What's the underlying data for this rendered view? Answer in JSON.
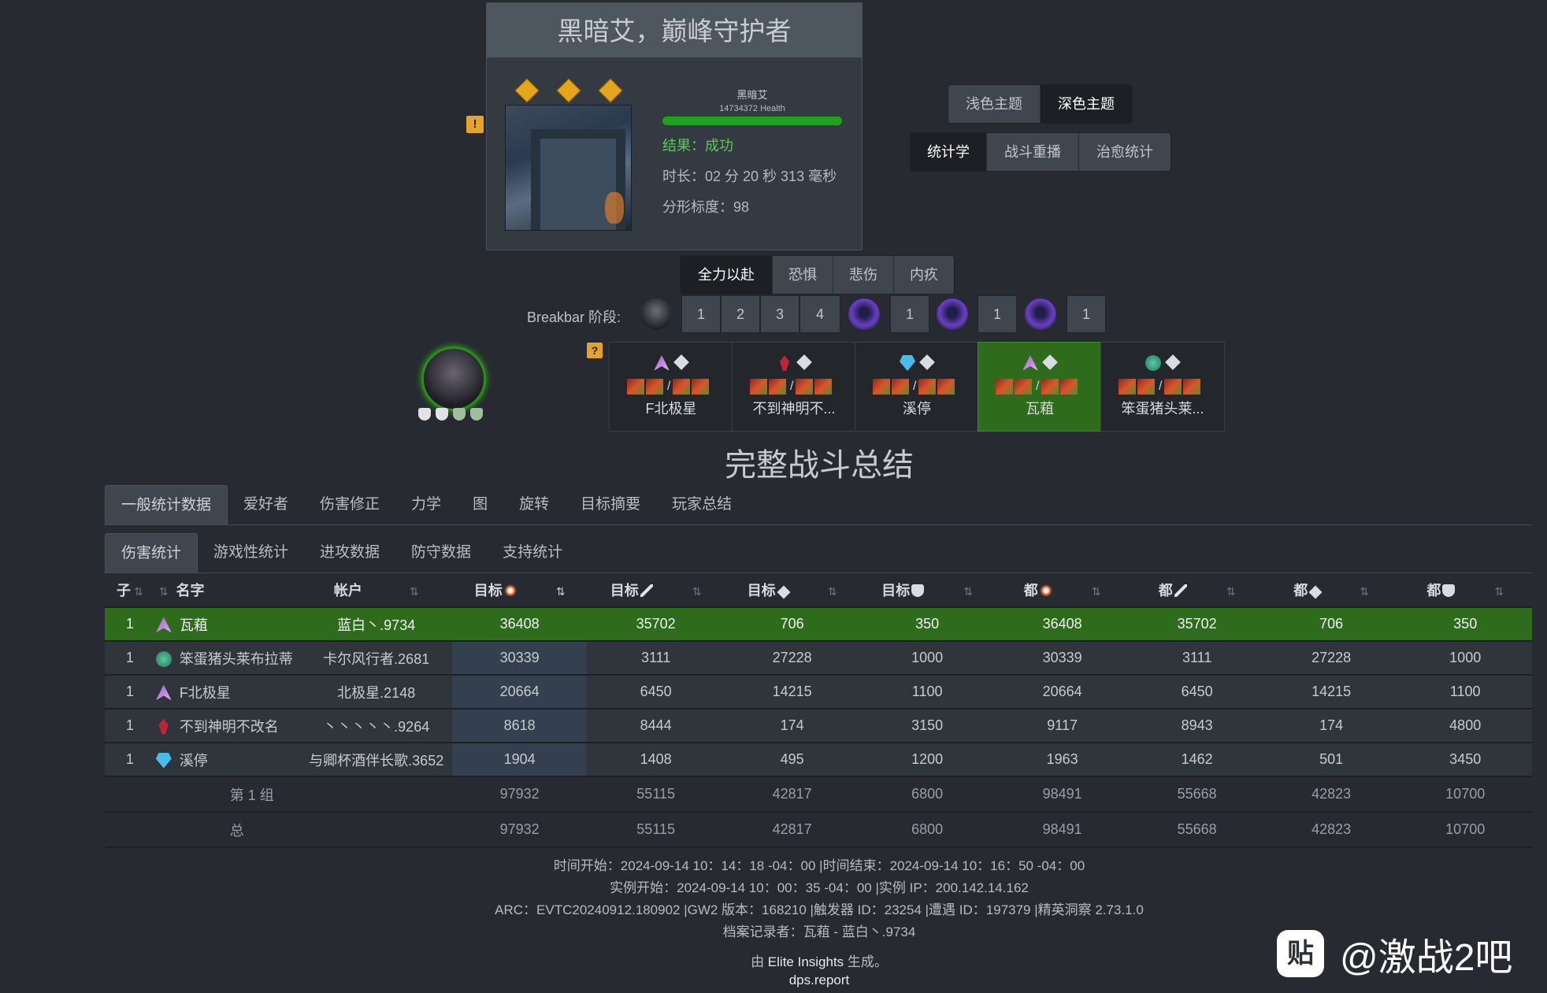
{
  "encounter": {
    "title": "黑暗艾，巅峰守护者",
    "boss_name": "黑暗艾",
    "boss_health": "14734372 Health",
    "boss_health_fraction": 1.0,
    "result": "结果：成功",
    "duration": "时长：02 分 20 秒 313 毫秒",
    "fractal_scale": "分形标度：98",
    "warning_icon": "!"
  },
  "theme": {
    "light": "浅色主题",
    "dark": "深色主题"
  },
  "view_tabs": [
    "统计学",
    "战斗重播",
    "治愈统计"
  ],
  "target_tabs": [
    "全力以赴",
    "恐惧",
    "悲伤",
    "内疚"
  ],
  "breakbar": {
    "label": "Breakbar 阶段:",
    "group1": [
      "1",
      "2",
      "3",
      "4"
    ],
    "single": "1"
  },
  "players": [
    {
      "name": "F北极星",
      "prof_icon": "revenant-icon",
      "selected": false
    },
    {
      "name": "不到神明不...",
      "prof_icon": "necromancer-icon",
      "selected": false
    },
    {
      "name": "溪停",
      "prof_icon": "elementalist-icon",
      "selected": false
    },
    {
      "name": "瓦蒩",
      "prof_icon": "revenant-icon",
      "selected": true
    },
    {
      "name": "笨蛋猪头莱...",
      "prof_icon": "engineer-icon",
      "selected": false
    }
  ],
  "player_warning": "?",
  "main_title": "完整战斗总结",
  "main_tabs": [
    "一般统计数据",
    "爱好者",
    "伤害修正",
    "力学",
    "图",
    "旋转",
    "目标摘要",
    "玩家总结"
  ],
  "sub_tabs": [
    "伤害统计",
    "游戏性统计",
    "进攻数据",
    "防守数据",
    "支持统计"
  ],
  "table": {
    "headers": {
      "sub": "子",
      "name": "名字",
      "account": "帐户",
      "target": "目标",
      "all": "都"
    },
    "rows": [
      {
        "sub": "1",
        "prof": "rev",
        "name": "瓦蒩",
        "account": "蓝白丶.9734",
        "vals": [
          "36408",
          "35702",
          "706",
          "350",
          "36408",
          "35702",
          "706",
          "350"
        ],
        "selected": true
      },
      {
        "sub": "1",
        "prof": "eng",
        "name": "笨蛋猪头莱布拉蒂",
        "account": "卡尔风行者.2681",
        "vals": [
          "30339",
          "3111",
          "27228",
          "1000",
          "30339",
          "3111",
          "27228",
          "1000"
        ],
        "selected": false
      },
      {
        "sub": "1",
        "prof": "rev",
        "name": "F北极星",
        "account": "北极星.2148",
        "vals": [
          "20664",
          "6450",
          "14215",
          "1100",
          "20664",
          "6450",
          "14215",
          "1100"
        ],
        "selected": false
      },
      {
        "sub": "1",
        "prof": "nec",
        "name": "不到神明不改名",
        "account": "丶丶丶丶丶.9264",
        "vals": [
          "8618",
          "8444",
          "174",
          "3150",
          "9117",
          "8943",
          "174",
          "4800"
        ],
        "selected": false
      },
      {
        "sub": "1",
        "prof": "ele",
        "name": "溪停",
        "account": "与卿杯酒伴长歌.3652",
        "vals": [
          "1904",
          "1408",
          "495",
          "1200",
          "1963",
          "1462",
          "501",
          "3450"
        ],
        "selected": false
      }
    ],
    "group": {
      "label": "第 1 组",
      "vals": [
        "97932",
        "55115",
        "42817",
        "6800",
        "98491",
        "55668",
        "42823",
        "10700"
      ]
    },
    "total": {
      "label": "总",
      "vals": [
        "97932",
        "55115",
        "42817",
        "6800",
        "98491",
        "55668",
        "42823",
        "10700"
      ]
    }
  },
  "footer": {
    "line1": "时间开始：2024-09-14 10：14：18 -04：00 |时间结束：2024-09-14 10：16：50 -04：00",
    "line2": "实例开始：2024-09-14 10：00：35 -04：00 |实例 IP：200.142.14.162",
    "line3": "ARC：EVTC20240912.180902 |GW2 版本：168210 |触发器 ID：23254 |遭遇 ID：197379 |精英洞察 2.73.1.0",
    "line4": "档案记录者：瓦蒩 - 蓝白丶.9734",
    "generated_prefix": "由",
    "generated_app": "Elite Insights",
    "generated_suffix": "生成。",
    "site": "dps.report"
  },
  "watermark": "@激战2吧",
  "colors": {
    "bg": "#272b31",
    "selected_row": "#2f6b1d",
    "success": "#5cc85c",
    "hp_bar": "#21a21c",
    "warn": "#e3a32c"
  }
}
